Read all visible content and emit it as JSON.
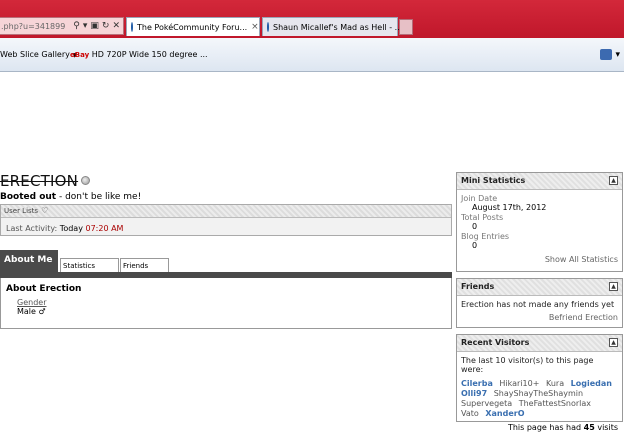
{
  "browser": {
    "address_fragment": ".php?u=341899",
    "tabs": [
      {
        "label": "The PokéCommunity Foru...",
        "close": "×"
      },
      {
        "label": "Shaun Micallef's Mad as Hell - ..."
      }
    ],
    "favorites": [
      {
        "label": "Web Slice Gallery"
      },
      {
        "label": "HD 720P Wide 150 degree ...",
        "prefix": "eBay"
      }
    ]
  },
  "profile": {
    "username": "ERECTION",
    "title_bold": "Booted out",
    "title_rest": " - don't be like me!",
    "userlists_label": "User Lists",
    "last_activity_label": "Last Activity:",
    "last_activity_day": "Today",
    "last_activity_time": "07:20 AM",
    "tabs": [
      "About Me",
      "Statistics",
      "Friends"
    ],
    "about_title": "About Erection",
    "gender_label": "Gender",
    "gender_value": "Male ♂"
  },
  "mini_stats": {
    "title": "Mini Statistics",
    "join_label": "Join Date",
    "join_value": "August 17th, 2012",
    "posts_label": "Total Posts",
    "posts_value": "0",
    "blog_label": "Blog Entries",
    "blog_value": "0",
    "footer": "Show All Statistics"
  },
  "friends": {
    "title": "Friends",
    "text": "Erection has not made any friends yet",
    "footer": "Befriend Erection"
  },
  "visitors": {
    "title": "Recent Visitors",
    "intro": "The last 10 visitor(s) to this page were:",
    "names": [
      {
        "name": "Cilerba",
        "bold": true
      },
      {
        "name": "Hikari10+",
        "bold": false
      },
      {
        "name": "Kura",
        "bold": false
      },
      {
        "name": "Logiedan",
        "bold": true
      },
      {
        "name": "Olli97",
        "bold": true
      },
      {
        "name": "ShayShayTheShaymin",
        "bold": false
      },
      {
        "name": "Supervegeta",
        "bold": false
      },
      {
        "name": "TheFattestSnorlax",
        "bold": false
      },
      {
        "name": "Vato",
        "bold": false
      },
      {
        "name": "XanderO",
        "bold": true
      }
    ],
    "count_pre": "This page has had ",
    "count": "45",
    "count_post": " visits"
  }
}
